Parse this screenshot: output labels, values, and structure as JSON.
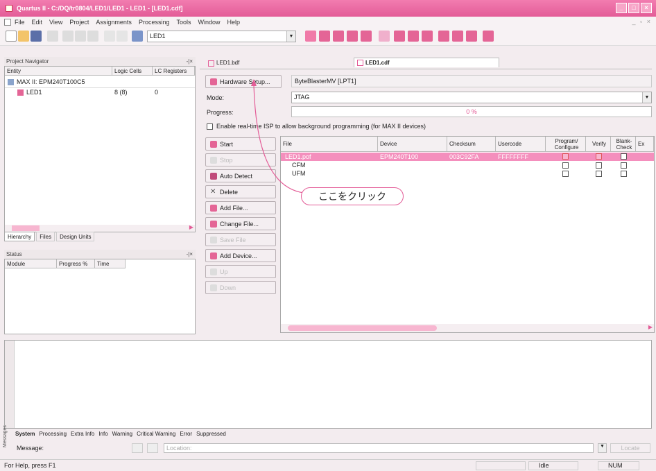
{
  "window": {
    "title": "Quartus II - C:/DQ/tr0804/LED1/LED1 - LED1 - [LED1.cdf]"
  },
  "menu": [
    "File",
    "Edit",
    "View",
    "Project",
    "Assignments",
    "Processing",
    "Tools",
    "Window",
    "Help"
  ],
  "toolbar": {
    "project_combo": "LED1"
  },
  "nav": {
    "title": "Project Navigator",
    "columns": [
      "Entity",
      "Logic Cells",
      "LC Registers"
    ],
    "device": "MAX II: EPM240T100C5",
    "row": {
      "name": "LED1",
      "logic_cells": "8 (8)",
      "lc_registers": "0"
    },
    "tabs": [
      "Hierarchy",
      "Files",
      "Design Units"
    ]
  },
  "status": {
    "title": "Status",
    "columns": [
      "Module",
      "Progress %",
      "Time"
    ]
  },
  "doc_tabs": [
    "LED1.bdf",
    "LED1.cdf"
  ],
  "programmer": {
    "hardware_setup": "Hardware Setup...",
    "hardware_name": "ByteBlasterMV [LPT1]",
    "mode_label": "Mode:",
    "mode_value": "JTAG",
    "progress_label": "Progress:",
    "progress_value": "0 %",
    "isp_checkbox": "Enable real-time ISP to allow background programming (for MAX II devices)",
    "buttons": [
      "Start",
      "Stop",
      "Auto Detect",
      "Delete",
      "Add File...",
      "Change File...",
      "Save File",
      "Add Device...",
      "Up",
      "Down"
    ],
    "table_headers": [
      "File",
      "Device",
      "Checksum",
      "Usercode",
      "Program/ Configure",
      "Verify",
      "Blank- Check",
      "Ex"
    ],
    "rows": [
      {
        "file": "LED1.pof",
        "device": "EPM240T100",
        "checksum": "003C92FA",
        "usercode": "FFFFFFFF"
      },
      {
        "file": "CFM"
      },
      {
        "file": "UFM"
      }
    ]
  },
  "annotation": {
    "callout": "ここをクリック"
  },
  "messages": {
    "tabs": [
      "System",
      "Processing",
      "Extra Info",
      "Info",
      "Warning",
      "Critical Warning",
      "Error",
      "Suppressed"
    ],
    "side_label": "Messages",
    "message_label": "Message:",
    "location_placeholder": "Location:",
    "locate_button": "Locate"
  },
  "statusbar": {
    "help": "For Help, press F1",
    "idle": "Idle",
    "num": "NUM"
  },
  "colors": {
    "accent": "#e35c97",
    "selected_row": "#f48fbd",
    "arrow": "#e35c97"
  }
}
